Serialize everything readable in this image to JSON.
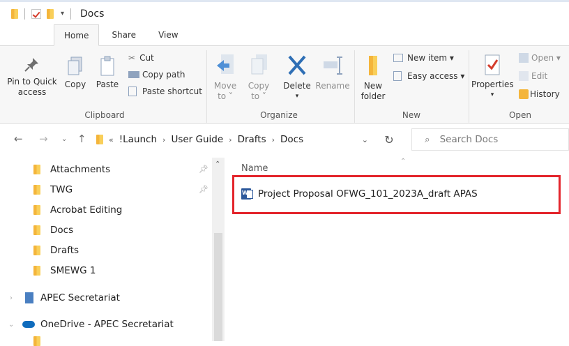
{
  "window": {
    "title": "Docs"
  },
  "ribbon_tabs": [
    {
      "label": "Home",
      "active": true
    },
    {
      "label": "Share"
    },
    {
      "label": "View"
    }
  ],
  "clipboard": {
    "pin_label_1": "Pin to Quick",
    "pin_label_2": "access",
    "copy": "Copy",
    "paste": "Paste",
    "cut": "Cut",
    "copy_path": "Copy path",
    "paste_shortcut": "Paste shortcut",
    "group": "Clipboard"
  },
  "organize": {
    "move_1": "Move",
    "move_2": "to ˅",
    "copy_1": "Copy",
    "copy_2": "to ˅",
    "delete": "Delete",
    "rename": "Rename",
    "group": "Organize"
  },
  "new": {
    "new_folder_1": "New",
    "new_folder_2": "folder",
    "new_item": "New item ▾",
    "easy_access": "Easy access ▾",
    "group": "New"
  },
  "open": {
    "properties": "Properties",
    "open": "Open ▾",
    "edit": "Edit",
    "history": "History",
    "group": "Open"
  },
  "address": {
    "crumbs": [
      "!Launch",
      "User Guide",
      "Drafts",
      "Docs"
    ],
    "overflow": "«",
    "search_placeholder": "Search Docs"
  },
  "nav": {
    "items": [
      "Attachments",
      "TWG",
      "Acrobat Editing",
      "Docs",
      "Drafts",
      "SMEWG 1"
    ],
    "apec": "APEC Secretariat",
    "onedrive": "OneDrive - APEC Secretariat"
  },
  "content": {
    "column_name": "Name",
    "files": [
      {
        "name": "Project Proposal OFWG_101_2023A_draft APAS"
      }
    ]
  },
  "colors": {
    "highlight": "#e3242b",
    "folder": "#f4b53b",
    "word": "#2b579a"
  }
}
